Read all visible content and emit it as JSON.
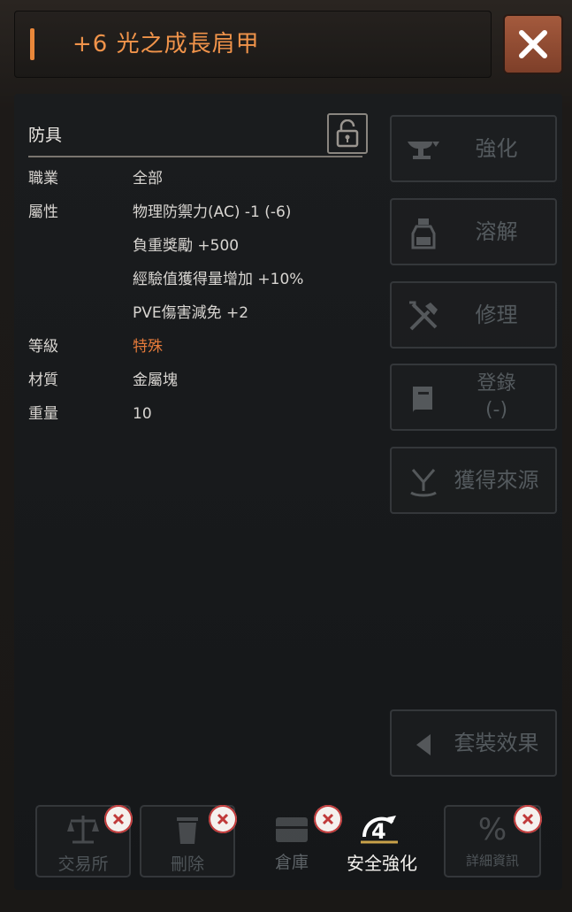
{
  "title": "+6 光之成長肩甲",
  "category": "防具",
  "attributes": {
    "job_label": "職業",
    "job_value": "全部",
    "prop_label": "屬性",
    "props": [
      "物理防禦力(AC) -1 (-6)",
      "負重獎勵 +500",
      "經驗值獲得量增加 +10%",
      "PVE傷害減免 +2"
    ],
    "grade_label": "等級",
    "grade_value": "特殊",
    "material_label": "材質",
    "material_value": "金屬塊",
    "weight_label": "重量",
    "weight_value": "10"
  },
  "side_buttons": {
    "enhance": "強化",
    "dissolve": "溶解",
    "repair": "修理",
    "register_line1": "登錄",
    "register_line2": "(-)",
    "source": "獲得來源",
    "set_effect": "套裝效果"
  },
  "bottom_buttons": {
    "exchange": "交易所",
    "delete": "刪除",
    "warehouse": "倉庫",
    "safe_enhance": "安全強化",
    "safe_enhance_count": "4",
    "detail": "詳細資訊"
  },
  "colors": {
    "accent": "#f0934a",
    "grade": "#e47a3a",
    "close_bg": "#a45a3d",
    "disabled_text": "#545a5e"
  }
}
